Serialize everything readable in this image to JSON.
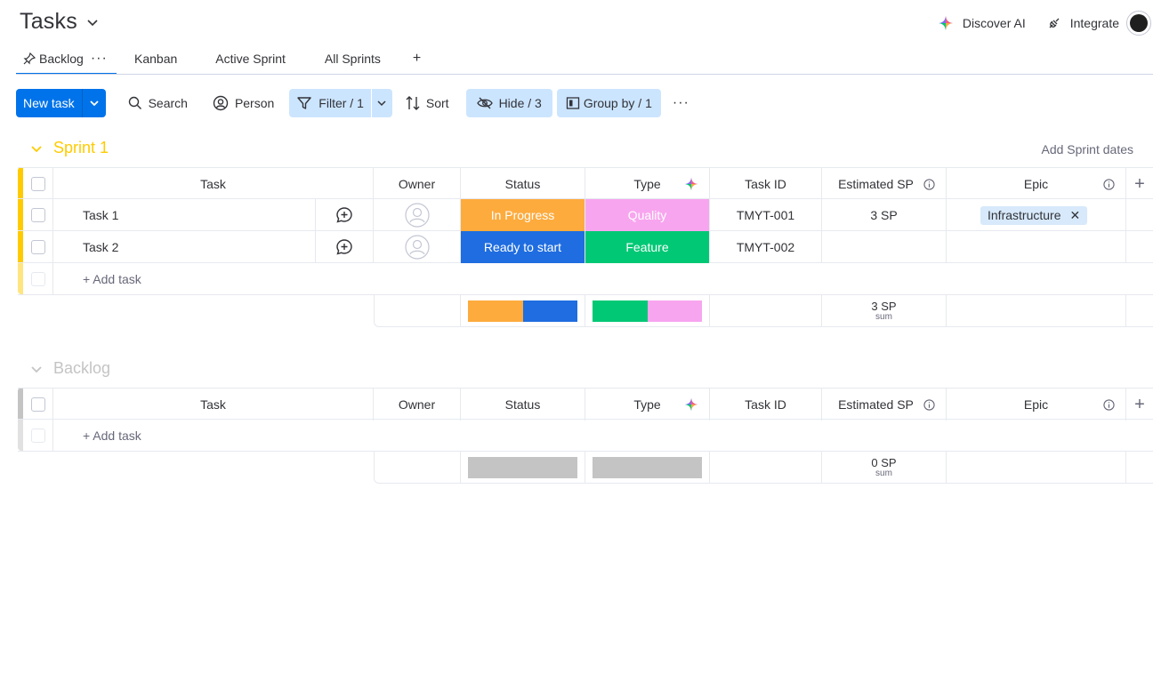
{
  "header": {
    "title": "Tasks",
    "discover_ai": "Discover AI",
    "integrate": "Integrate"
  },
  "tabs": [
    {
      "label": "Backlog",
      "active": true
    },
    {
      "label": "Kanban"
    },
    {
      "label": "Active Sprint"
    },
    {
      "label": "All Sprints"
    },
    {
      "label": "+"
    }
  ],
  "toolbar": {
    "new_task": "New task",
    "search": "Search",
    "person": "Person",
    "filter": "Filter / 1",
    "sort": "Sort",
    "hide": "Hide / 3",
    "group_by": "Group by / 1",
    "more": "···"
  },
  "columns": {
    "task": "Task",
    "owner": "Owner",
    "status": "Status",
    "type": "Type",
    "task_id": "Task ID",
    "estimated_sp": "Estimated SP",
    "epic": "Epic",
    "add": "+"
  },
  "sprint": {
    "title": "Sprint 1",
    "add_dates": "Add Sprint dates",
    "color": "#ffcb00",
    "rows": [
      {
        "task": "Task 1",
        "status": "In Progress",
        "status_color": "#fdab3d",
        "type": "Quality",
        "type_color": "#f8a5ef",
        "task_id": "TMYT-001",
        "sp": "3 SP",
        "epic": "Infrastructure"
      },
      {
        "task": "Task 2",
        "status": "Ready to start",
        "status_color": "#1f6de0",
        "type": "Feature",
        "type_color": "#00c875",
        "task_id": "TMYT-002",
        "sp": "",
        "epic": ""
      }
    ],
    "add_task": "+ Add task",
    "sum_value": "3 SP",
    "sum_label": "sum",
    "status_summary": [
      {
        "color": "#fdab3d",
        "share": 0.5
      },
      {
        "color": "#1f6de0",
        "share": 0.5
      }
    ],
    "type_summary": [
      {
        "color": "#00c875",
        "share": 0.5
      },
      {
        "color": "#f8a5ef",
        "share": 0.5
      }
    ]
  },
  "backlog": {
    "title": "Backlog",
    "color": "#c4c4c4",
    "add_task": "+ Add task",
    "sum_value": "0 SP",
    "sum_label": "sum"
  }
}
